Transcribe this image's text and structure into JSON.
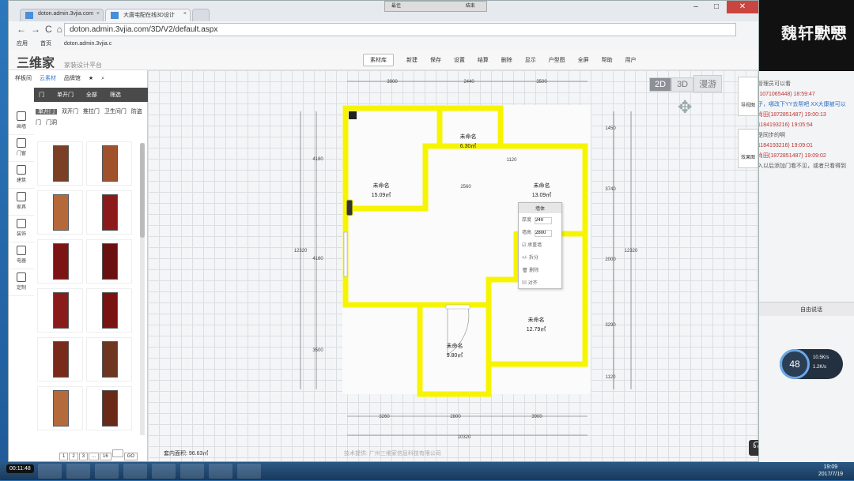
{
  "browser": {
    "tabs": [
      {
        "label": "doton.admin.3vjia.com"
      },
      {
        "label": "大唐宅配在线3D设计"
      }
    ],
    "recorder": {
      "btn1": "最佳",
      "btn2": "结束"
    },
    "url": "doton.admin.3vjia.com/3D/V2/default.aspx",
    "bookmarks": [
      "应用",
      "首页",
      "doton.admin.3vjia.c"
    ]
  },
  "app": {
    "logo": "三维家",
    "logo_sub": "家装设计平台",
    "toolbar": [
      "素材库",
      "新建",
      "保存",
      "设置",
      "结算",
      "删除",
      "显示",
      "户型图",
      "全屏",
      "帮助",
      "用户"
    ],
    "left_tabs": [
      "样板间",
      "云素材",
      "品牌馆"
    ],
    "filter": [
      "门",
      "单开门",
      "全部",
      "筛选"
    ],
    "categories": [
      "单开门",
      "双开门",
      "推拉门",
      "卫生间门",
      "防盗门",
      "门洞"
    ],
    "vnav": [
      "画墙",
      "门窗",
      "建筑",
      "家具",
      "装饰",
      "电器",
      "定制"
    ],
    "pager": [
      "1",
      "2",
      "3",
      "...",
      "16",
      "GO"
    ],
    "area_text": "套内面积: 96.63㎡",
    "footer": "技术提供: 广州三维家信息科技有限公司"
  },
  "canvas": {
    "modes": [
      "2D",
      "3D",
      "漫游"
    ],
    "side_buttons": [
      "导视图",
      "效果图"
    ],
    "rooms": [
      {
        "name": "未命名",
        "area": "15.09㎡"
      },
      {
        "name": "未命名",
        "area": "6.30㎡"
      },
      {
        "name": "未命名",
        "area": "13.09㎡"
      },
      {
        "name": "未命名",
        "area": "12.79㎡"
      },
      {
        "name": "未命名",
        "area": "9.80㎡"
      }
    ],
    "dims_top": [
      "3900",
      "2440",
      "3500"
    ],
    "dims_bottom": [
      "3260",
      "2800",
      "3900"
    ],
    "dim_total_bottom": "10320",
    "dims_left": [
      "4180",
      "4160",
      "3500"
    ],
    "dims_right": [
      "1450",
      "3740",
      "2000",
      "3290",
      "1120"
    ],
    "dim_total": "12320",
    "wall_labels": [
      "2560",
      "1120"
    ],
    "context_menu": {
      "title": "墙体",
      "thickness_label": "厚度",
      "thickness_value": "240",
      "height_label": "墙高",
      "height_value": "2800",
      "items": [
        "承重墙",
        "拆分",
        "删除",
        "对齐"
      ]
    }
  },
  "desktop": {
    "watermark": "魏轩默思",
    "brand": "bilibili",
    "chat": [
      "管理员可以看",
      "(1071065448) 18:59:47",
      "子，哪改下YY去帮吧 XX大康被可以",
      "肖田(1872851487) 19:00:13",
      "1184193216) 19:05:54",
      "是同步的啊",
      "1184193216) 19:09:01",
      "肖田(1872851487) 19:09:02",
      "入以后添加门看不见，或者只看得到"
    ],
    "chat_bar": "自由说话",
    "gauge": {
      "percent": "48",
      "up": "10.5K/s",
      "down": "1.2K/s"
    },
    "rec_time": "00:11:48",
    "clock_time": "19:09",
    "clock_date": "2017/7/19"
  }
}
